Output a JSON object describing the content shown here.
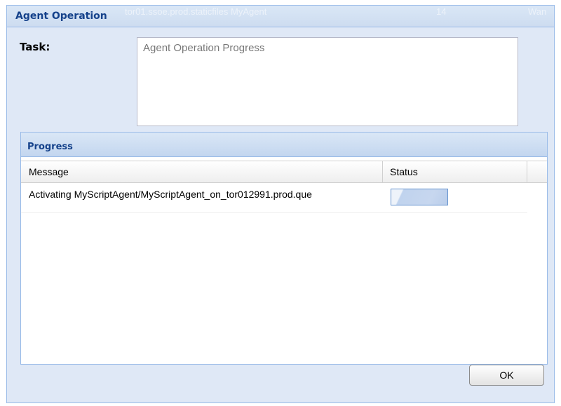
{
  "dialog": {
    "title": "Agent Operation",
    "background_fragments": [
      "",
      "tor01.ssoe.prod.staticfiles MyAgent",
      "14",
      "Wan"
    ]
  },
  "task": {
    "label": "Task:",
    "value": "Agent Operation Progress"
  },
  "progress": {
    "title": "Progress",
    "columns": [
      "Message",
      "Status"
    ],
    "rows": [
      {
        "message": "Activating MyScriptAgent/MyScriptAgent_on_tor012991.prod.que",
        "status_progress": 1.0
      }
    ]
  },
  "footer": {
    "ok_label": "OK"
  },
  "colors": {
    "title_text": "#15428b",
    "panel_border": "#99bbe8",
    "dialog_bg": "#dfe8f6"
  }
}
